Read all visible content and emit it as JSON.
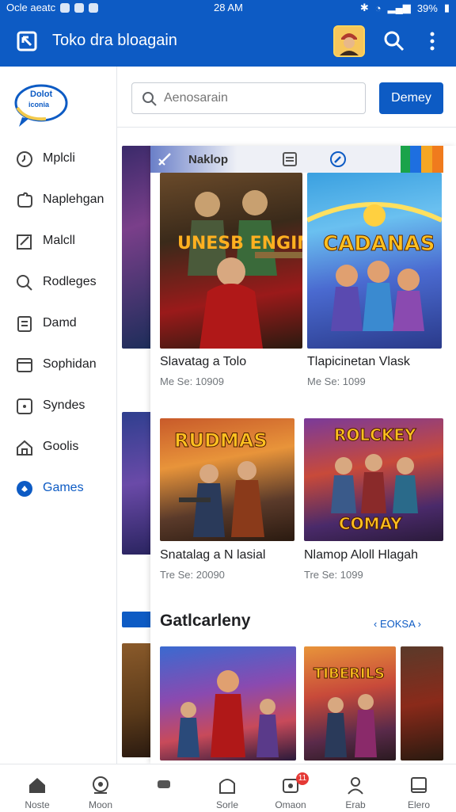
{
  "status_bar": {
    "left_text": "Ocle aeatc",
    "time": "28 AM",
    "battery": "39%"
  },
  "app_bar": {
    "title": "Toko dra bloagain"
  },
  "sidebar": {
    "brand_line1": "Dolot",
    "brand_line2": "iconia",
    "items": [
      {
        "label": "Mplcli",
        "icon": "clock-icon"
      },
      {
        "label": "Naplehgan",
        "icon": "puzzle-icon"
      },
      {
        "label": "Malcll",
        "icon": "edit-icon"
      },
      {
        "label": "Rodleges",
        "icon": "search-icon"
      },
      {
        "label": "Damd",
        "icon": "list-icon"
      },
      {
        "label": "Sophidan",
        "icon": "window-icon"
      },
      {
        "label": "Syndes",
        "icon": "square-icon"
      },
      {
        "label": "Goolis",
        "icon": "home-icon"
      },
      {
        "label": "Games",
        "icon": "gamepad-icon",
        "active": true
      }
    ]
  },
  "search": {
    "placeholder": "Aenosarain",
    "button_label": "Demey"
  },
  "toolbar": {
    "label": "Naklop"
  },
  "games": [
    {
      "art_title": "UNESB ENGINE",
      "name": "Slavatag a Tolo",
      "meta": "Me Se: 10909"
    },
    {
      "art_title": "CADANAS",
      "name": "Tlapicinetan Vlask",
      "meta": "Me Se: 1099"
    },
    {
      "art_title": "RUDMAS",
      "name": "Snatalag a N lasial",
      "meta": "Tre Se: 20090"
    },
    {
      "art_title": "ROLCKEY",
      "art_subtitle": "COMAY",
      "name": "Nlamop Aloll Hlagah",
      "meta": "Tre Se: 1099"
    }
  ],
  "section": {
    "title": "Gatlcarleny",
    "link": "EOKSA"
  },
  "bottom_row": [
    {
      "art_title": ""
    },
    {
      "art_title": "TIBERILS"
    },
    {
      "art_title": ""
    }
  ],
  "bottom_nav": [
    {
      "label": "Noste",
      "icon": "home-icon"
    },
    {
      "label": "Moon",
      "icon": "compass-icon"
    },
    {
      "label": "",
      "icon": "chat-icon"
    },
    {
      "label": "Sorle",
      "icon": "shelf-icon"
    },
    {
      "label": "Omaon",
      "icon": "bell-icon",
      "badge": "11"
    },
    {
      "label": "Erab",
      "icon": "profile-icon"
    },
    {
      "label": "Elero",
      "icon": "window-icon"
    }
  ],
  "colors": {
    "brand_blue": "#0d5bc4",
    "text_dark": "#202124",
    "text_muted": "#70757a"
  }
}
